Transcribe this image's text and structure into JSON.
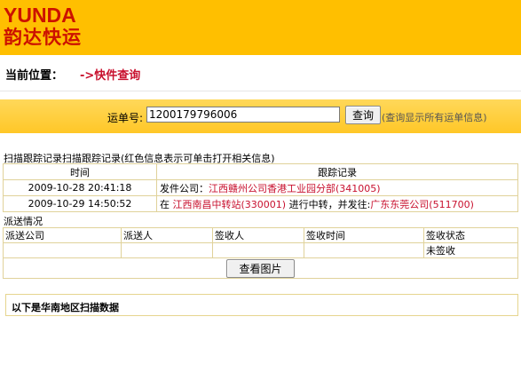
{
  "header": {
    "logo_en": "YUNDA",
    "logo_cn": "韵达快运",
    "bg_color": "#ffbf00",
    "brand_color": "#cc1100"
  },
  "location": {
    "label": "当前位置：",
    "crumb": "->快件查询"
  },
  "search": {
    "label": "运单号:",
    "value": "1200179796006",
    "button": "查询",
    "hint": "(查询显示所有运单信息)"
  },
  "tracking": {
    "title": "扫描跟踪记录扫描跟踪记录(红色信息表示可单击打开相关信息)",
    "headers": [
      "时间",
      "跟踪记录"
    ],
    "rows": [
      {
        "time": "2009-10-28 20:41:18",
        "prefix": "发件公司：",
        "link1": "江西赣州公司香港工业园分部(341005)",
        "middle": "",
        "link2": ""
      },
      {
        "time": "2009-10-29 14:50:52",
        "prefix": "在 ",
        "link1": "江西南昌中转站(330001)",
        "middle": "进行中转，并发往:",
        "link2": "广东东莞公司(511700)"
      }
    ]
  },
  "dispatch": {
    "title": "派送情况",
    "headers": [
      "派送公司",
      "派送人",
      "签收人",
      "签收时间",
      "签收状态"
    ],
    "row": [
      "",
      "",
      "",
      "",
      "未签收"
    ],
    "photo_button": "查看图片"
  },
  "south": {
    "text": "以下是华南地区扫描数据"
  }
}
